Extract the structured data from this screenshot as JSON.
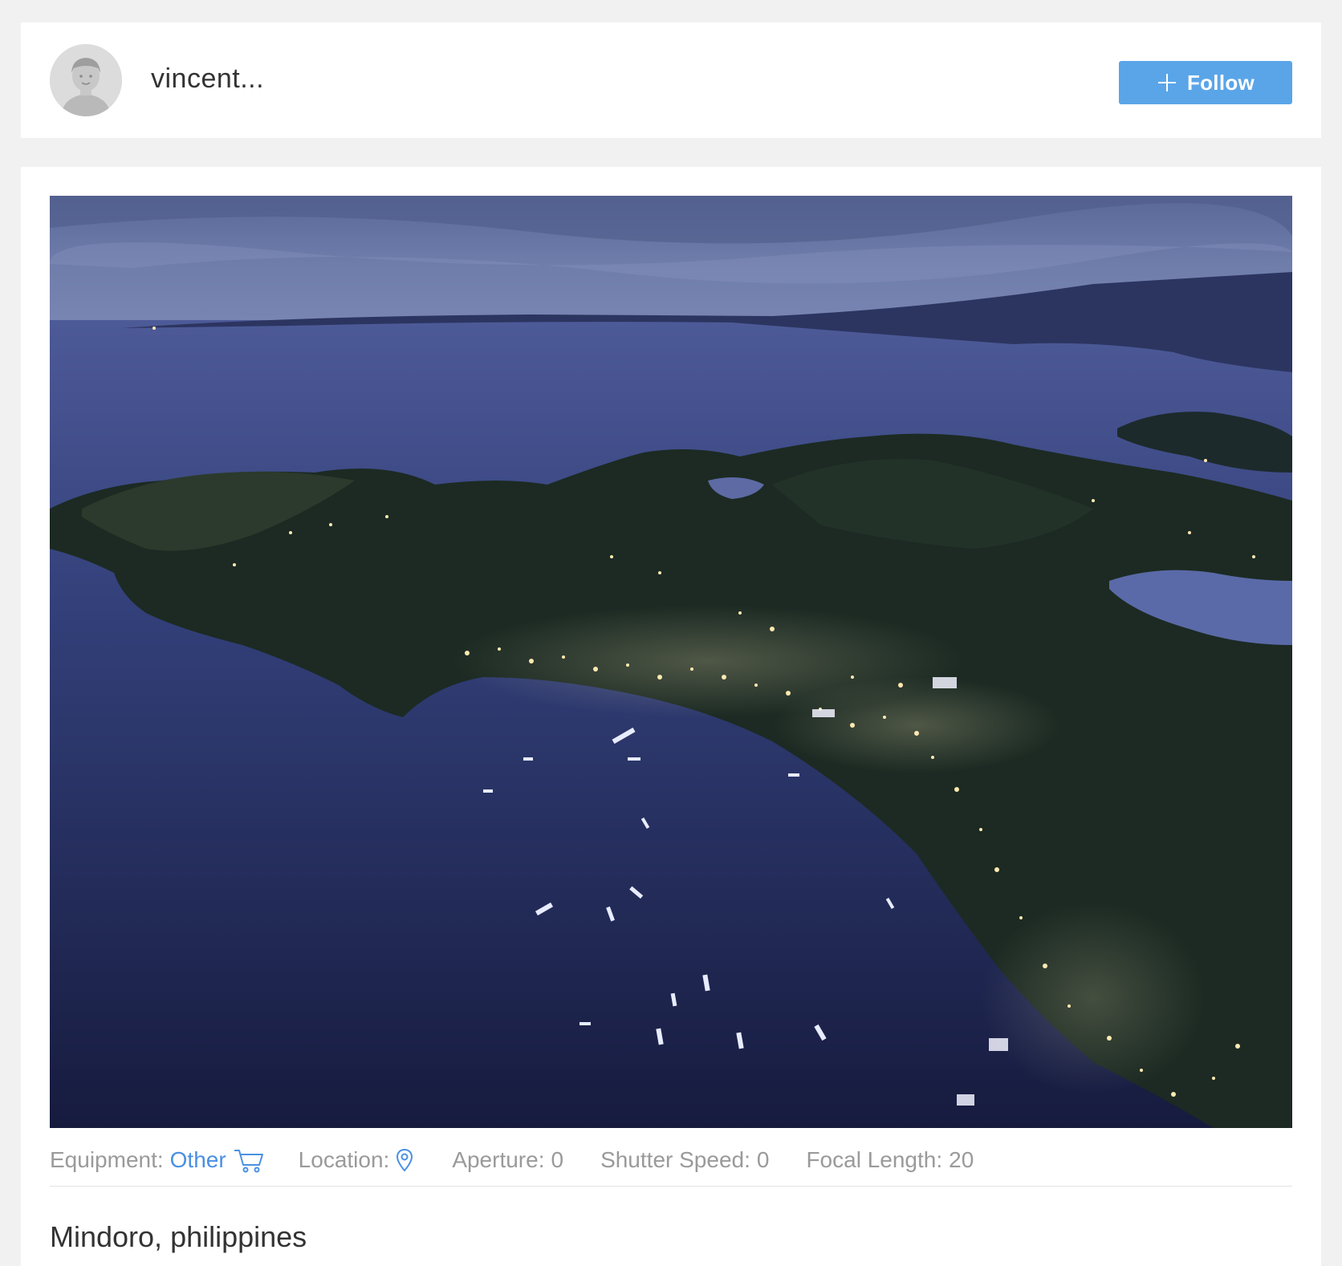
{
  "header": {
    "username": "vincent...",
    "follow_label": "Follow",
    "avatar_icon": "default-user-avatar",
    "follow_icon": "plus-icon"
  },
  "post": {
    "photo_description_icon": "aerial-photo",
    "meta": {
      "equipment_label": "Equipment:",
      "equipment_value": "Other",
      "equipment_icon": "cart-icon",
      "location_label": "Location:",
      "location_icon": "map-pin-icon",
      "aperture_label": "Aperture:",
      "aperture_value": "0",
      "shutter_label": "Shutter Speed:",
      "shutter_value": "0",
      "focal_label": "Focal Length:",
      "focal_value": "20"
    },
    "caption": "Mindoro, philippines"
  },
  "colors": {
    "accent": "#4a90e2",
    "follow_button": "#5aa5e8",
    "page_background": "#f1f1f1"
  }
}
